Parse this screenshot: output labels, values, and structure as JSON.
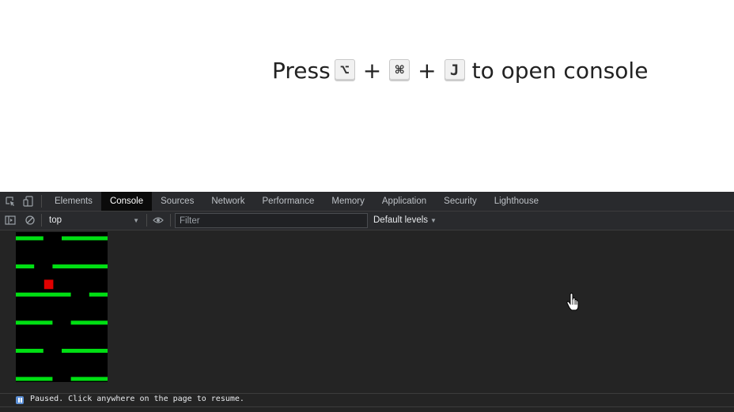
{
  "headline": {
    "prefix": "Press",
    "keys": [
      "⌥",
      "⌘",
      "J"
    ],
    "separator": "+",
    "suffix": "to open console"
  },
  "devtools": {
    "tabs": [
      {
        "label": "Elements",
        "active": false
      },
      {
        "label": "Console",
        "active": true
      },
      {
        "label": "Sources",
        "active": false
      },
      {
        "label": "Network",
        "active": false
      },
      {
        "label": "Performance",
        "active": false
      },
      {
        "label": "Memory",
        "active": false
      },
      {
        "label": "Application",
        "active": false
      },
      {
        "label": "Security",
        "active": false
      },
      {
        "label": "Lighthouse",
        "active": false
      }
    ],
    "toolbar": {
      "context": "top",
      "filter_placeholder": "Filter",
      "levels": "Default levels"
    },
    "status": {
      "paused_text": "Paused. Click anywhere on the page to resume."
    },
    "icons": {
      "inspect": "inspect-element-icon",
      "device": "device-toggle-icon",
      "sidebar": "sidebar-toggle-icon",
      "clear": "clear-console-icon",
      "eye": "live-expression-eye-icon",
      "paused": "paused-badge-icon",
      "cursor": "hand-pointer-icon"
    }
  },
  "game": {
    "background": "#000000",
    "platform_color": "#00e013",
    "player_color": "#e00000",
    "columns": 10,
    "rows": 16,
    "platform_rows": [
      {
        "row": 0,
        "gaps": [
          3,
          4
        ]
      },
      {
        "row": 3,
        "gaps": [
          2,
          3
        ]
      },
      {
        "row": 6,
        "gaps": [
          6,
          7
        ]
      },
      {
        "row": 9,
        "gaps": [
          4,
          5
        ]
      },
      {
        "row": 12,
        "gaps": [
          3,
          4
        ]
      },
      {
        "row": 15,
        "gaps": [
          4,
          5
        ]
      }
    ],
    "player": {
      "col": 3,
      "row": 5
    }
  },
  "colors": {
    "devtools_bg": "#242424",
    "tab_active_bg": "#0b0b0b",
    "badge_blue": "#5b8fd6"
  }
}
